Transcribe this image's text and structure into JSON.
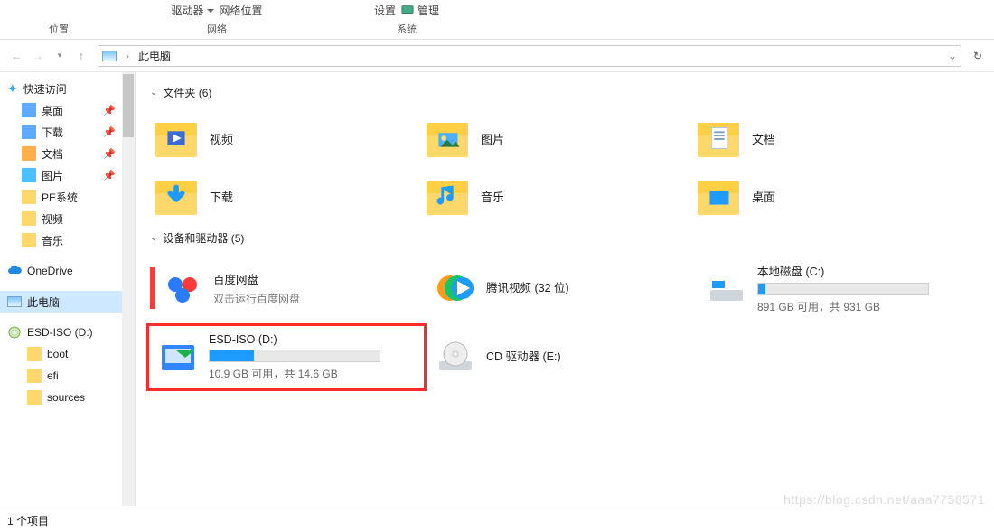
{
  "ribbon": {
    "group1": {
      "top1": "驱动器",
      "top2": "网络位置",
      "label": "位置"
    },
    "group2": {
      "label": "网络"
    },
    "group3": {
      "top1": "设置",
      "top2": "管理",
      "label": "系统"
    }
  },
  "address": {
    "crumb_icon": "pc",
    "crumb": "此电脑"
  },
  "sidebar": {
    "quick": "快速访问",
    "items": [
      {
        "label": "桌面",
        "pin": true
      },
      {
        "label": "下载",
        "pin": true
      },
      {
        "label": "文档",
        "pin": true
      },
      {
        "label": "图片",
        "pin": true
      },
      {
        "label": "PE系统",
        "pin": false
      },
      {
        "label": "视频",
        "pin": false
      },
      {
        "label": "音乐",
        "pin": false
      }
    ],
    "onedrive": "OneDrive",
    "thispc": "此电脑",
    "esd": "ESD-ISO (D:)",
    "esd_children": [
      "boot",
      "efi",
      "sources"
    ]
  },
  "sections": {
    "folders": {
      "title": "文件夹 (6)",
      "items": [
        "视频",
        "图片",
        "文档",
        "下载",
        "音乐",
        "桌面"
      ]
    },
    "devices": {
      "title": "设备和驱动器 (5)"
    }
  },
  "devices": {
    "baidu": {
      "name": "百度网盘",
      "sub": "双击运行百度网盘"
    },
    "tencent": {
      "name": "腾讯视频 (32 位)"
    },
    "c": {
      "name": "本地磁盘 (C:)",
      "free": "891 GB 可用，共 931 GB",
      "fill": 4
    },
    "d": {
      "name": "ESD-ISO (D:)",
      "free": "10.9 GB 可用，共 14.6 GB",
      "fill": 26
    },
    "e": {
      "name": "CD 驱动器 (E:)"
    }
  },
  "status": "1 个项目",
  "watermark": "https://blog.csdn.net/aaa7758571"
}
